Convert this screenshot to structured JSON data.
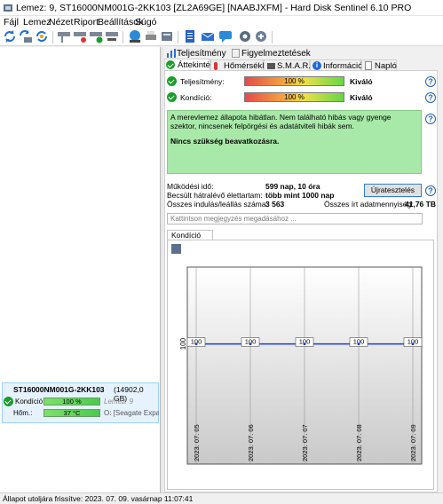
{
  "window": {
    "title": "Lemez: 9, ST16000NM001G-2KK103 [ZL2A69GE]  [NAABJXFM]  -  Hard Disk Sentinel 6.10 PRO"
  },
  "menu": [
    "Fájl",
    "Lemez",
    "Nézet",
    "Riport",
    "Beállítások",
    "Súgó"
  ],
  "tabs_top": {
    "t1": "Teljesítmény",
    "t2": "Figyelmeztetések"
  },
  "tabs": {
    "overview": "Áttekintés",
    "temperature": "Hőmérséklet",
    "smart": "S.M.A.R.T.",
    "info": "Információk",
    "log": "Napló"
  },
  "overview": {
    "perf_label": "Teljesítmény:",
    "perf_value": "100 %",
    "perf_rating": "Kiváló",
    "perf_fill": 1.0,
    "health_label": "Kondíció:",
    "health_value": "100 %",
    "health_rating": "Kiváló",
    "health_fill": 1.0,
    "status_text": "A merevlemez állapota hibátlan. Nem található hibás vagy gyenge szektor, nincsenek felpörgési és adatátviteli hibák sem.",
    "status_action": "Nincs szükség beavatkozásra.",
    "uptime_label": "Működési idő:",
    "uptime_value": "599 nap, 10 óra",
    "remaining_label": "Becsült hátralévő élettartam:",
    "remaining_value": "több mint 1000 nap",
    "startstop_label": "Összes indulás/leállás száma:",
    "startstop_value": "3 563",
    "written_label": "Összes írt adatmennyiség:",
    "written_value": "41,76 TB",
    "retest_button": "Újratesztelés",
    "note_placeholder": "Kattintson megjegyzés megadásához ..."
  },
  "chart_tab": "Kondíció  (%)",
  "chart_data": {
    "type": "line",
    "x": [
      "2023. 07. 05",
      "2023. 07. 06",
      "2023. 07. 07",
      "2023. 07. 08",
      "2023. 07. 09"
    ],
    "values": [
      100,
      100,
      100,
      100,
      100
    ],
    "ytick": "100",
    "color": "#1f3bd6"
  },
  "disk": {
    "name": "ST16000NM001G-2KK103",
    "size": "(14902,0 GB)",
    "health_label": "Kondíció:",
    "health_value": "100 %",
    "health_fill": 1.0,
    "disk_index": "Lemez: 9",
    "temp_label": "Hőm.:",
    "temp_value": "37 °C",
    "temp_fill": 1.0,
    "mount": "O: [Seagate Expansion"
  },
  "statusbar": "Állapot utoljára frissítve: 2023. 07. 09. vasárnap 11:07:41",
  "colors": {
    "green": "#1a9d2a",
    "status_bg": "#a8e8a8",
    "line": "#1f3bd6"
  }
}
